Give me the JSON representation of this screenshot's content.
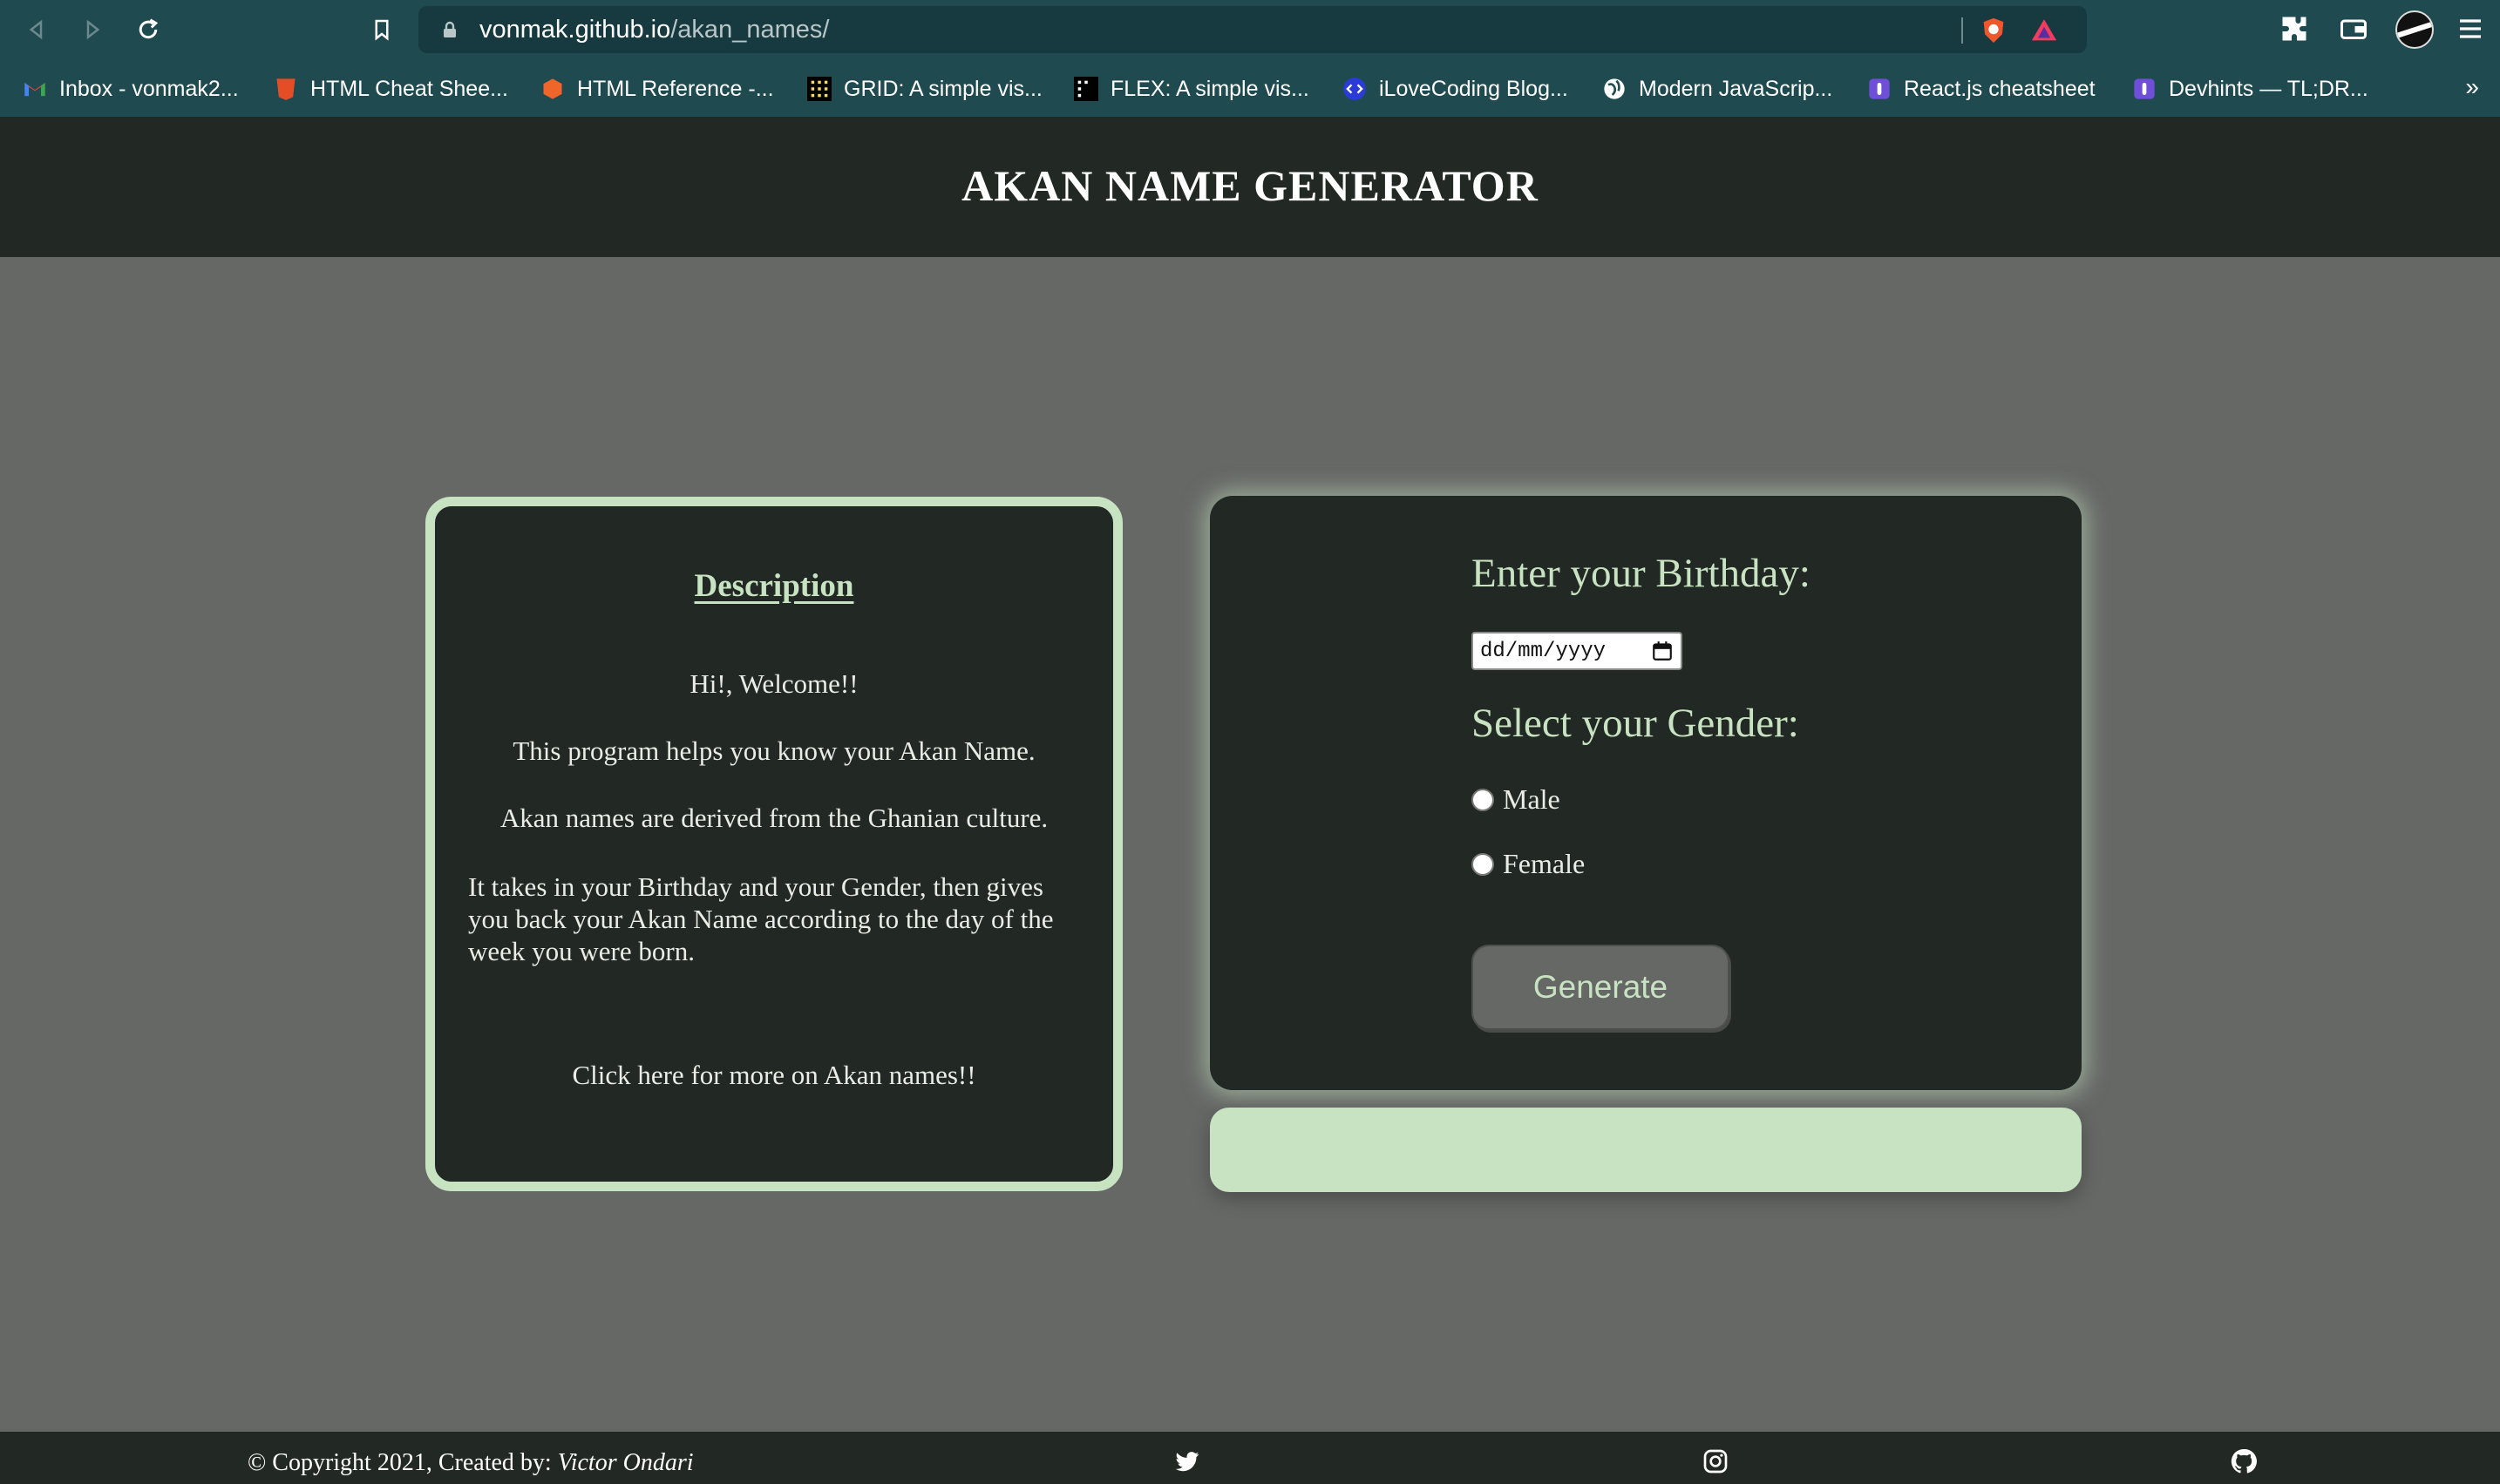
{
  "browser": {
    "url_host": "vonmak.github.io",
    "url_path": "/akan_names/",
    "bookmarks": [
      {
        "label": "Inbox - vonmak2...",
        "icon": "gmail-icon"
      },
      {
        "label": "HTML Cheat Shee...",
        "icon": "html-icon"
      },
      {
        "label": "HTML Reference -...",
        "icon": "html-reference-icon"
      },
      {
        "label": "GRID: A simple vis...",
        "icon": "grid-icon"
      },
      {
        "label": "FLEX: A simple vis...",
        "icon": "flex-icon"
      },
      {
        "label": "iLoveCoding Blog...",
        "icon": "ilovecoding-icon"
      },
      {
        "label": "Modern JavaScrip...",
        "icon": "globe-icon"
      },
      {
        "label": "React.js cheatsheet",
        "icon": "devhints-icon"
      },
      {
        "label": "Devhints — TL;DR...",
        "icon": "devhints-icon"
      }
    ],
    "more_label": "»"
  },
  "header": {
    "title": "AKAN NAME GENERATOR"
  },
  "description": {
    "title": "Description",
    "greeting": "Hi!, Welcome!!",
    "line1": "This program helps you know your Akan Name.",
    "line2": "Akan names are derived from the Ghanian culture.",
    "line3": "It takes in your Birthday and your Gender, then gives you back your Akan Name according to the day of the week you were born.",
    "link": "Click here for more on Akan names!!"
  },
  "form": {
    "birthday_label": "Enter your Birthday:",
    "date_placeholder": "dd/mm/yyyy",
    "gender_label": "Select your Gender:",
    "options": [
      "Male",
      "Female"
    ],
    "button": "Generate"
  },
  "result": {
    "text": ""
  },
  "footer": {
    "copyright": "© Copyright 2021, Created by:",
    "author": "Victor Ondari",
    "icons": [
      "twitter-icon",
      "instagram-icon",
      "github-icon"
    ]
  },
  "colors": {
    "page_bg": "#666866",
    "panel_bg": "#222824",
    "accent": "#c8e3c1",
    "chrome_bg": "#1f4a4f"
  }
}
